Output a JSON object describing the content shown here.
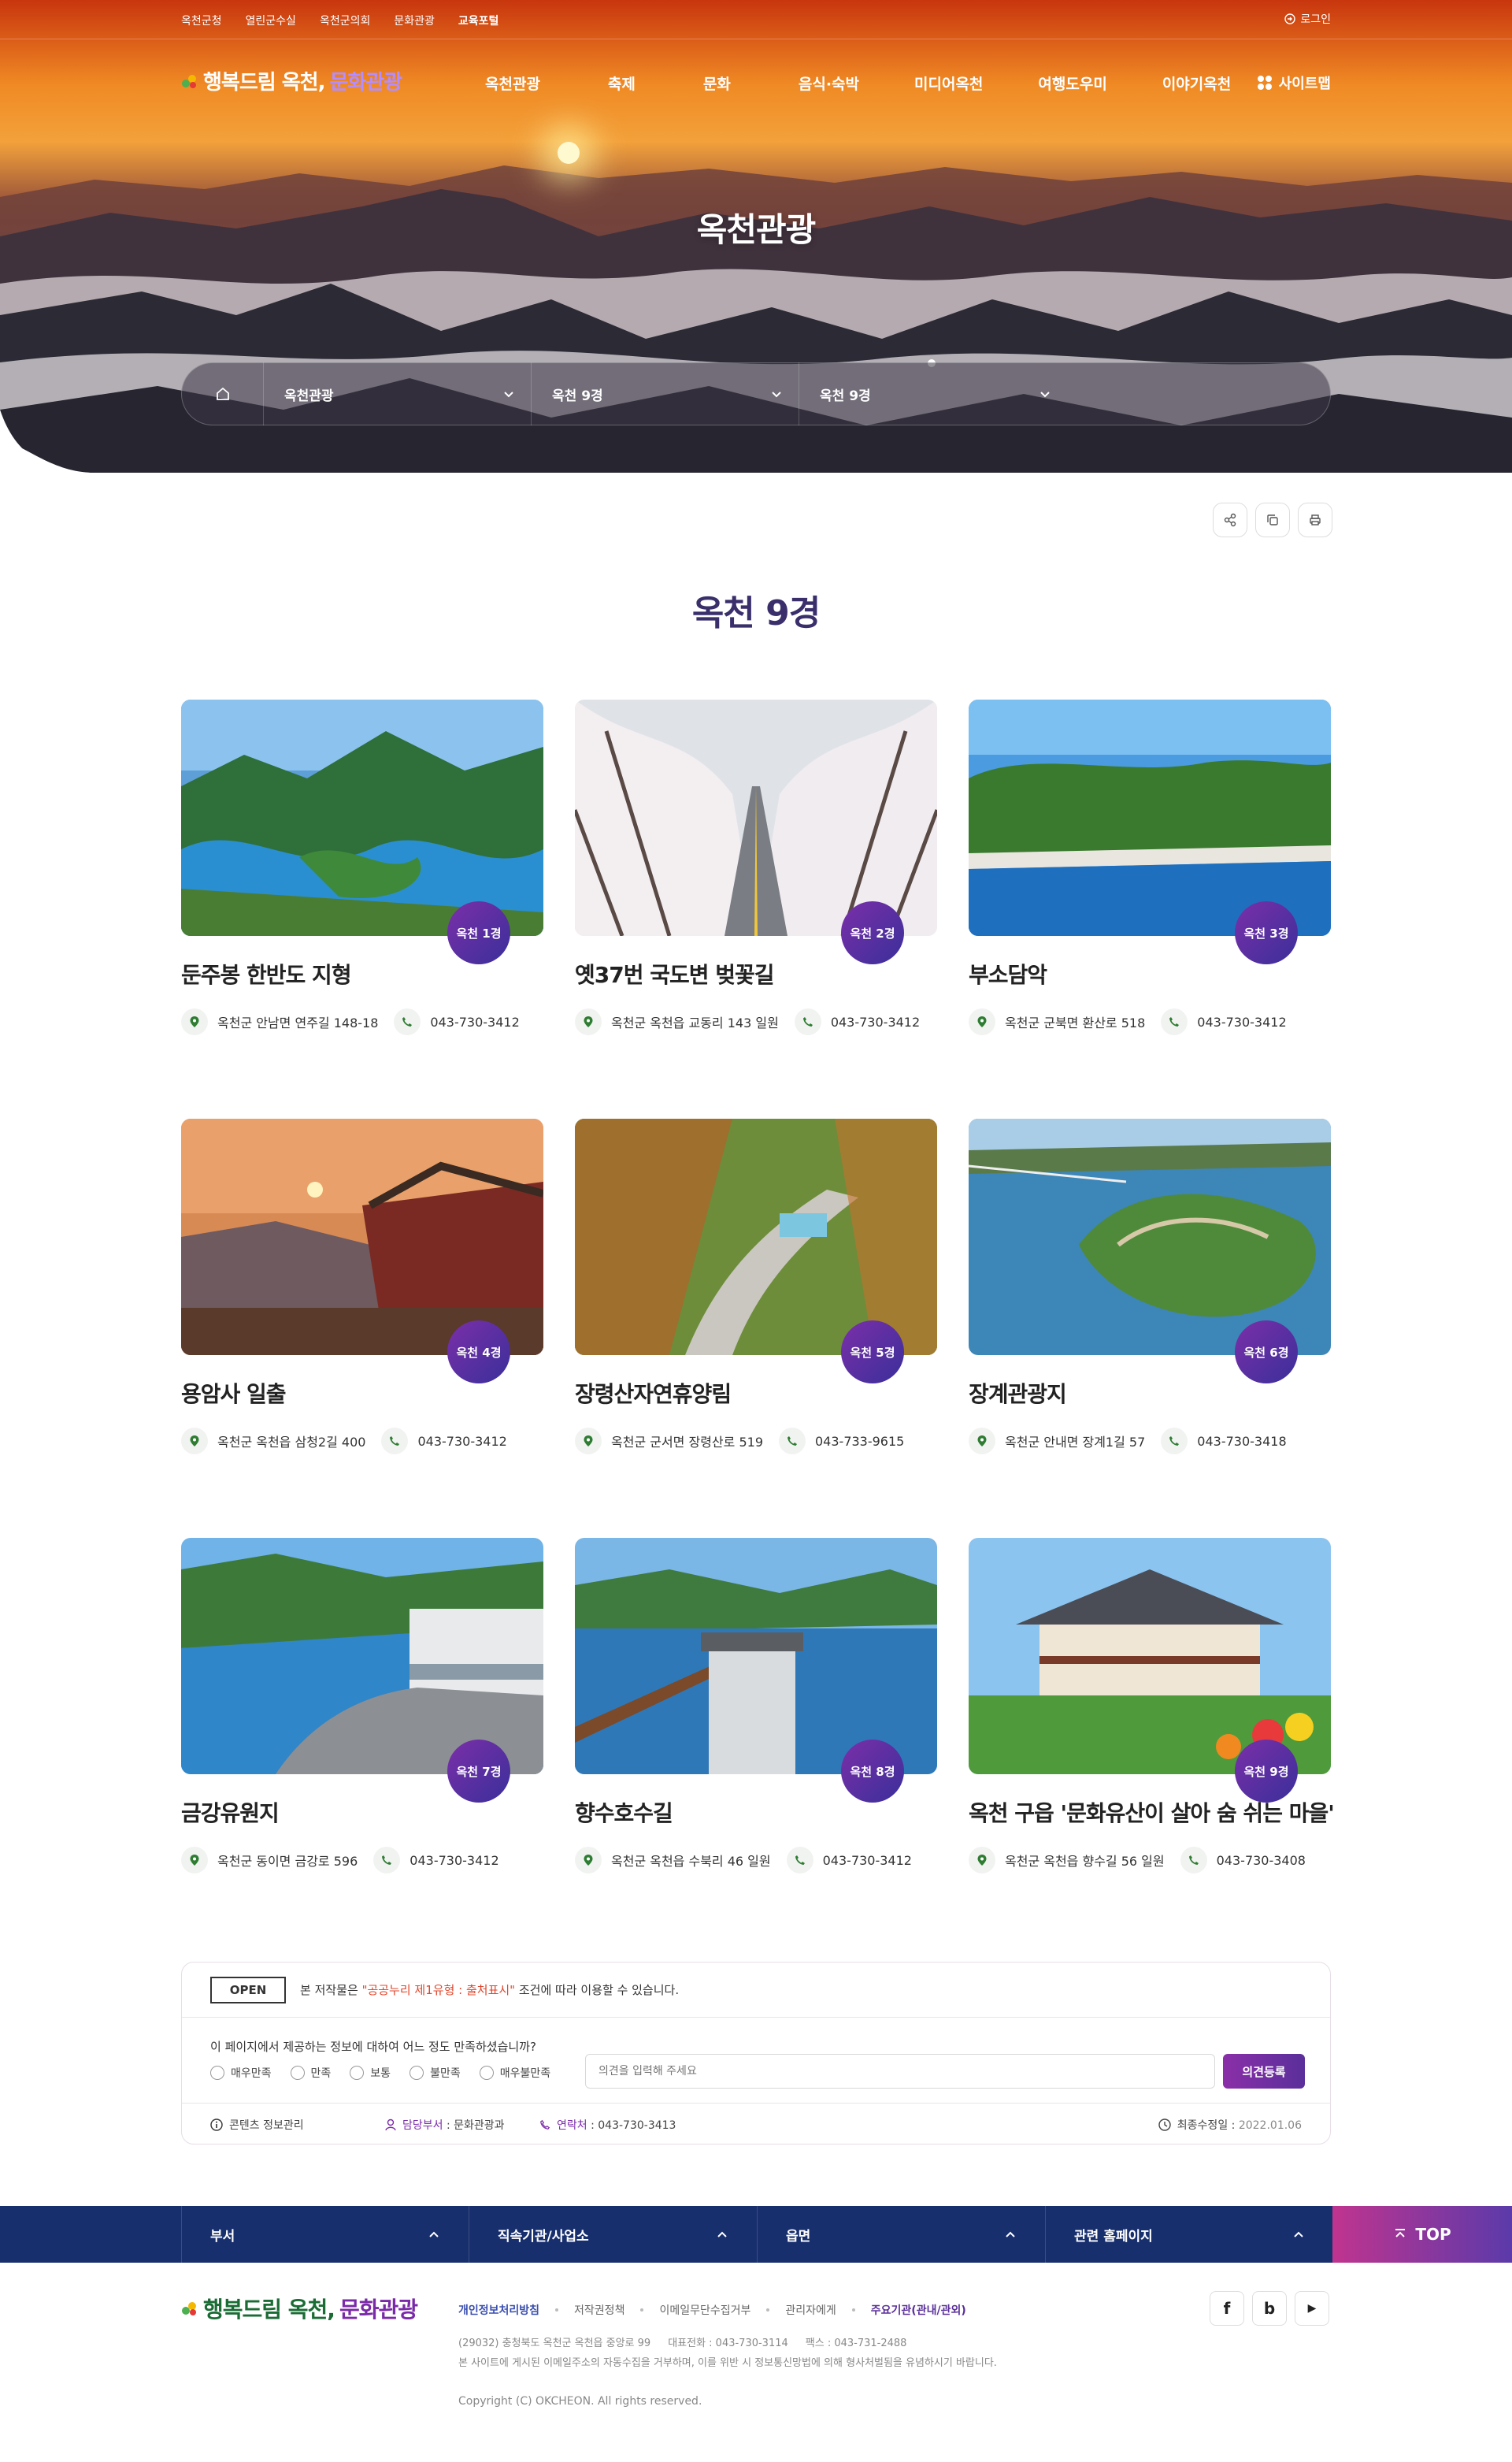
{
  "topbar": {
    "links": [
      "옥천군청",
      "열린군수실",
      "옥천군의회",
      "문화관광",
      "교육포털"
    ],
    "login": "로그인"
  },
  "header": {
    "logo_main": "행복드림 옥천,",
    "logo_sub": "문화관광",
    "menu": [
      "옥천관광",
      "축제",
      "문화",
      "음식·숙박",
      "미디어옥천",
      "여행도우미",
      "이야기옥천"
    ],
    "sitemap": "사이트맵"
  },
  "hero": {
    "title": "옥천관광"
  },
  "location": {
    "level1": "옥천관광",
    "level2": "옥천 9경",
    "level3": "옥천 9경"
  },
  "page": {
    "title": "옥천 9경"
  },
  "spots": [
    {
      "badge": "옥천 1경",
      "name": "둔주봉 한반도 지형",
      "address": "옥천군 안남면 연주길 148-18",
      "phone": "043-730-3412"
    },
    {
      "badge": "옥천 2경",
      "name": "옛37번 국도변 벚꽃길",
      "address": "옥천군 옥천읍 교동리 143 일원",
      "phone": "043-730-3412"
    },
    {
      "badge": "옥천 3경",
      "name": "부소담악",
      "address": "옥천군 군북면 환산로 518",
      "phone": "043-730-3412"
    },
    {
      "badge": "옥천 4경",
      "name": "용암사 일출",
      "address": "옥천군 옥천읍 삼청2길 400",
      "phone": "043-730-3412"
    },
    {
      "badge": "옥천 5경",
      "name": "장령산자연휴양림",
      "address": "옥천군 군서면 장령산로 519",
      "phone": "043-733-9615"
    },
    {
      "badge": "옥천 6경",
      "name": "장계관광지",
      "address": "옥천군 안내면 장계1길 57",
      "phone": "043-730-3418"
    },
    {
      "badge": "옥천 7경",
      "name": "금강유원지",
      "address": "옥천군 동이면 금강로 596",
      "phone": "043-730-3412"
    },
    {
      "badge": "옥천 8경",
      "name": "향수호수길",
      "address": "옥천군 옥천읍 수북리 46 일원",
      "phone": "043-730-3412"
    },
    {
      "badge": "옥천 9경",
      "name": "옥천 구읍 '문화유산이 살아 숨 쉬는 마을'",
      "address": "옥천군 옥천읍 향수길 56 일원",
      "phone": "043-730-3408"
    }
  ],
  "survey": {
    "open_label": "OPEN",
    "license_pre": "본 저작물은",
    "license_highlight": "\"공공누리 제1유형 : 출처표시\"",
    "license_post": "조건에 따라 이용할 수 있습니다.",
    "question": "이 페이지에서 제공하는 정보에 대하여 어느 정도 만족하셨습니까?",
    "options": [
      "매우만족",
      "만족",
      "보통",
      "불만족",
      "매우불만족"
    ],
    "placeholder": "의견을 입력해 주세요",
    "submit": "의견등록",
    "content_manage": "콘텐츠 정보관리",
    "dept_label": "담당부서",
    "dept": "문화관광과",
    "contact_label": "연락처",
    "contact": "043-730-3413",
    "updated_label": "최종수정일",
    "updated": "2022.01.06"
  },
  "footer": {
    "bar": [
      "부서",
      "직속기관/사업소",
      "읍면",
      "관련 홈페이지"
    ],
    "top": "TOP",
    "links": [
      "개인정보처리방침",
      "저작권정책",
      "이메일무단수집거부",
      "관리자에게",
      "주요기관(관내/관외)"
    ],
    "address": "(29032) 충청북도 옥천군 옥천읍 중앙로 99",
    "tel": "대표전화 : 043-730-3114",
    "fax": "팩스 : 043-731-2488",
    "notice": "본 사이트에 게시된 이메일주소의 자동수집을 거부하며, 이를 위반 시 정보통신망법에 의해 형사처벌됨을 유념하시기 바랍니다.",
    "copyright": "Copyright (C) OKCHEON. All rights reserved.",
    "social": [
      "f",
      "b",
      "▶"
    ]
  },
  "colors": {
    "navy": "#182f6e",
    "purple": "#7a2aa8",
    "title": "#3a2f6b"
  }
}
